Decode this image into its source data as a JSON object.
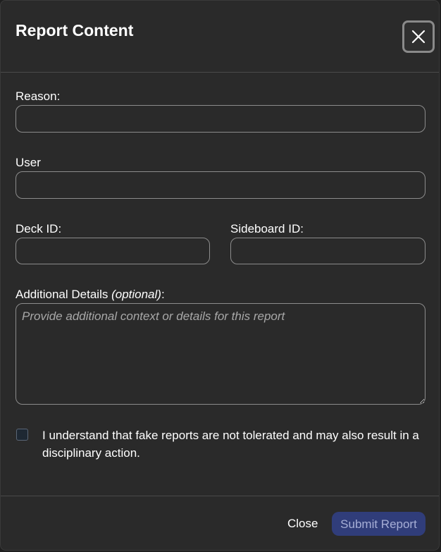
{
  "dialog": {
    "title": "Report Content",
    "close_icon": "close-icon"
  },
  "form": {
    "reason": {
      "label": "Reason:",
      "value": "",
      "placeholder": ""
    },
    "user": {
      "label": "User",
      "value": "",
      "placeholder": ""
    },
    "deck_id": {
      "label": "Deck ID:",
      "value": "",
      "placeholder": ""
    },
    "sideboard_id": {
      "label": "Sideboard ID:",
      "value": "",
      "placeholder": ""
    },
    "details": {
      "label": "Additional Details ",
      "label_optional": "(optional)",
      "label_suffix": ":",
      "value": "",
      "placeholder": "Provide additional context or details for this report"
    },
    "acknowledge": {
      "checked": false,
      "text": "I understand that fake reports are not tolerated and may also result in a disciplinary action."
    }
  },
  "footer": {
    "close_label": "Close",
    "submit_label": "Submit Report"
  },
  "colors": {
    "background": "#2a2a2a",
    "border": "#8c8c8c",
    "submit_bg": "#303d7a",
    "submit_text": "#a6aed6"
  }
}
